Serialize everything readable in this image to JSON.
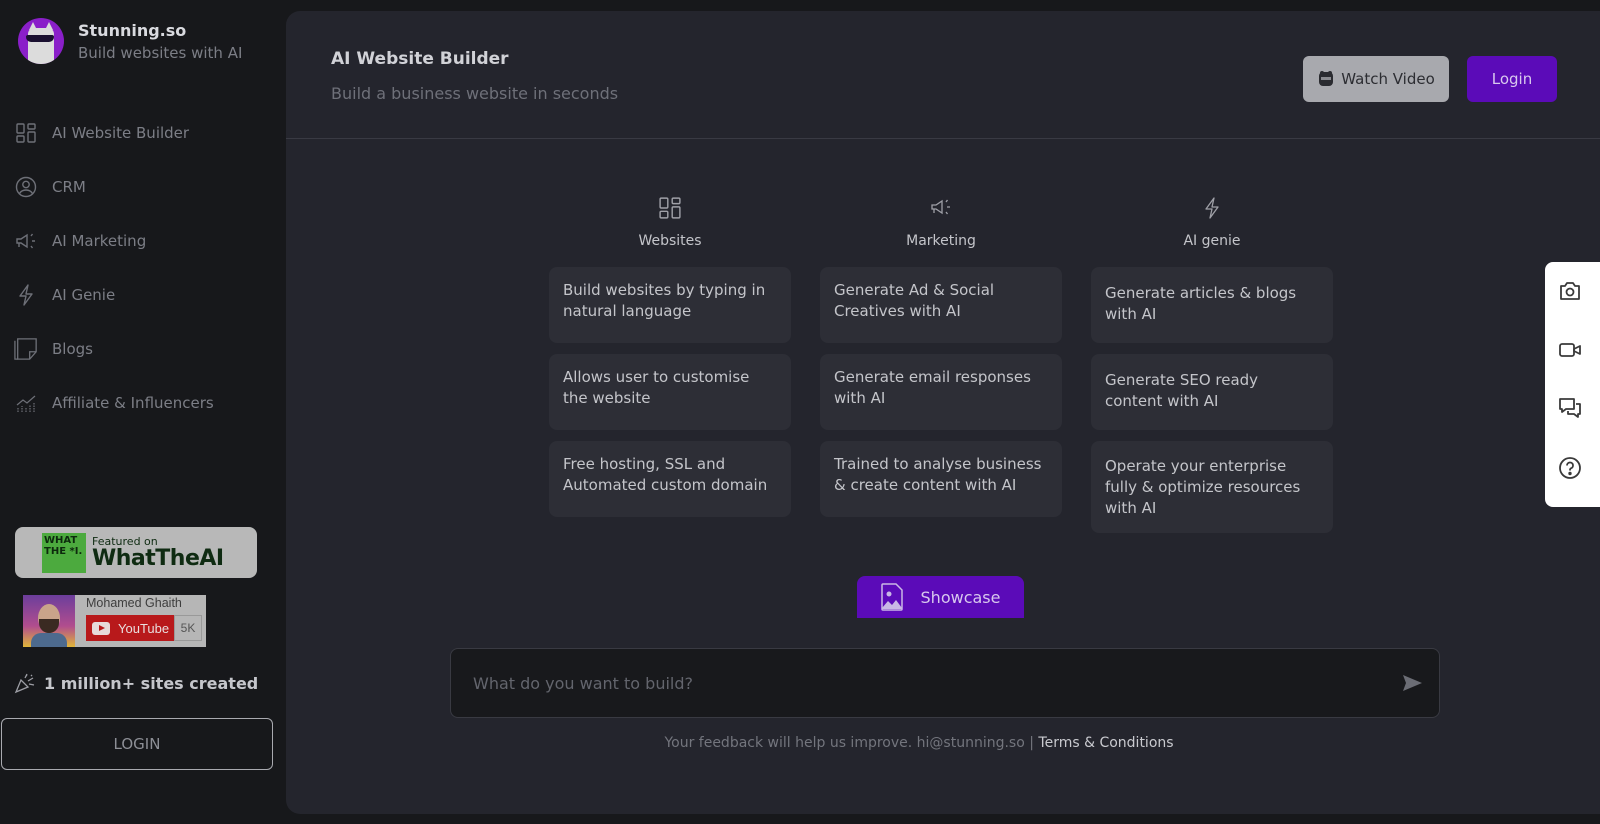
{
  "brand": {
    "name": "Stunning.so",
    "tagline": "Build websites with AI"
  },
  "sidebar": {
    "items": [
      {
        "label": "AI Website Builder",
        "icon": "grid-icon"
      },
      {
        "label": "CRM",
        "icon": "user-circle-icon"
      },
      {
        "label": "AI Marketing",
        "icon": "megaphone-icon"
      },
      {
        "label": "AI Genie",
        "icon": "lightning-icon"
      },
      {
        "label": "Blogs",
        "icon": "notes-icon"
      },
      {
        "label": "Affiliate & Influencers",
        "icon": "chart-growth-icon"
      }
    ],
    "featured": {
      "logo_text": "WHAT THE *I.",
      "small": "Featured on",
      "big": "WhatTheAI"
    },
    "youtube": {
      "channel": "Mohamed Ghaith",
      "button": "YouTube",
      "count": "5K"
    },
    "sites_created": "1 million+ sites created",
    "login_label": "LOGIN"
  },
  "header": {
    "title": "AI Website Builder",
    "subtitle": "Build a business website in seconds",
    "watch_video": "Watch Video",
    "login": "Login"
  },
  "columns": [
    {
      "title": "Websites",
      "icon": "grid-icon",
      "cards": [
        "Build websites by typing in natural language",
        "Allows user to customise the website",
        "Free hosting, SSL and Automated custom domain"
      ]
    },
    {
      "title": "Marketing",
      "icon": "megaphone-icon",
      "cards": [
        "Generate Ad & Social Creatives with AI",
        "Generate email responses with AI",
        "Trained to analyse business & create content with AI"
      ]
    },
    {
      "title": "AI genie",
      "icon": "lightning-icon",
      "cards": [
        "Generate articles & blogs with AI",
        "Generate SEO ready content with AI",
        "Operate your enterprise fully & optimize resources with AI"
      ]
    }
  ],
  "showcase": {
    "label": "Showcase"
  },
  "prompt": {
    "placeholder": "What do you want to build?",
    "value": ""
  },
  "footer": {
    "text": "Your feedback will help us improve. hi@stunning.so | ",
    "terms": "Terms & Conditions"
  },
  "colors": {
    "accent": "#5b0bb8",
    "panel": "#24252d",
    "background": "#17181b",
    "card": "#2d2e36"
  }
}
